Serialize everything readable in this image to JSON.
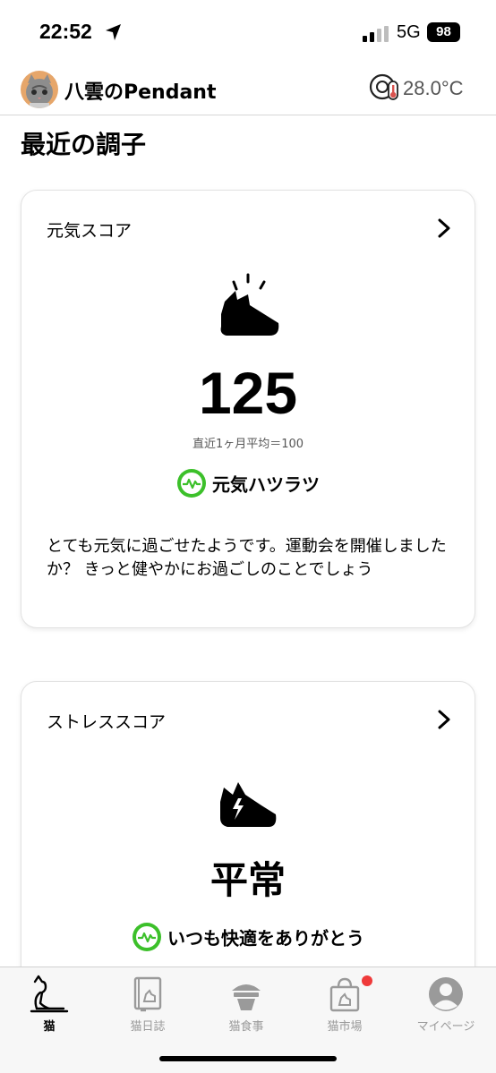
{
  "status_bar": {
    "time": "22:52",
    "network": "5G",
    "battery": "98"
  },
  "header": {
    "title": "八雲のPendant",
    "temperature": "28.0°C",
    "icons": [
      "cat-avatar",
      "thermo-device-icon"
    ]
  },
  "section_title": "最近の調子",
  "genki_card": {
    "title": "元気スコア",
    "score": "125",
    "average": "直近1ヶ月平均＝100",
    "status": "元気ハツラツ",
    "description": "とても元気に過ごせたようです。運動会を開催しましたか？ きっと健やかにお過ごしのことでしょう"
  },
  "stress_card": {
    "title": "ストレススコア",
    "level": "平常",
    "status": "いつも快適をありがとう"
  },
  "tabs": [
    {
      "label": "猫",
      "icon": "cat-icon",
      "active": true
    },
    {
      "label": "猫日誌",
      "icon": "journal-icon",
      "active": false
    },
    {
      "label": "猫食事",
      "icon": "food-bowl-icon",
      "active": false
    },
    {
      "label": "猫市場",
      "icon": "shopping-bag-icon",
      "active": false,
      "badge": true
    },
    {
      "label": "マイページ",
      "icon": "profile-icon",
      "active": false
    }
  ],
  "colors": {
    "accent_green": "#3cc02a",
    "badge_red": "#ef3a3a",
    "tab_inactive": "#9a9a9a"
  }
}
